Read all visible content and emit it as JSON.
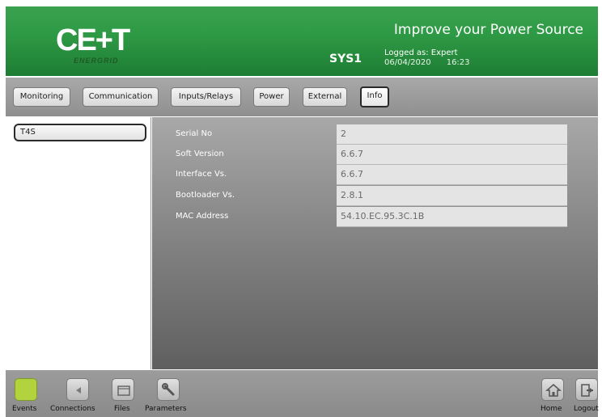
{
  "header": {
    "logo_text": "CE+T",
    "logo_sub": "ENERGRID",
    "slogan": "Improve your Power Source",
    "sys_name": "SYS1",
    "logged_as": "Logged as: Expert",
    "date": "06/04/2020",
    "time": "16:23",
    "date_time": "06/04/2020      16:23"
  },
  "tabs": [
    {
      "label": "Monitoring"
    },
    {
      "label": "Communication"
    },
    {
      "label": "Inputs/Relays"
    },
    {
      "label": "Power"
    },
    {
      "label": "External"
    },
    {
      "label": "Info",
      "active": true
    }
  ],
  "sidebar": {
    "items": [
      {
        "label": "T4S",
        "selected": true
      }
    ]
  },
  "info": {
    "rows": [
      {
        "label": "Serial No",
        "value": "2"
      },
      {
        "label": "Soft Version",
        "value": "6.6.7"
      },
      {
        "label": "Interface Vs.",
        "value": "6.6.7"
      },
      {
        "label": "Bootloader Vs.",
        "value": "2.8.1"
      },
      {
        "label": "MAC Address",
        "value": "54.10.EC.95.3C.1B"
      }
    ]
  },
  "footer": {
    "items": [
      {
        "label": "Events",
        "icon": "events-icon"
      },
      {
        "label": "Connections",
        "icon": "connections-icon"
      },
      {
        "label": "Files",
        "icon": "files-icon"
      },
      {
        "label": "Parameters",
        "icon": "wrench-icon"
      },
      {
        "label": "Home",
        "icon": "home-icon"
      },
      {
        "label": "Logout",
        "icon": "logout-icon"
      }
    ]
  },
  "colors": {
    "header_green": "#2e9a45",
    "events_green": "#b2d33e"
  }
}
